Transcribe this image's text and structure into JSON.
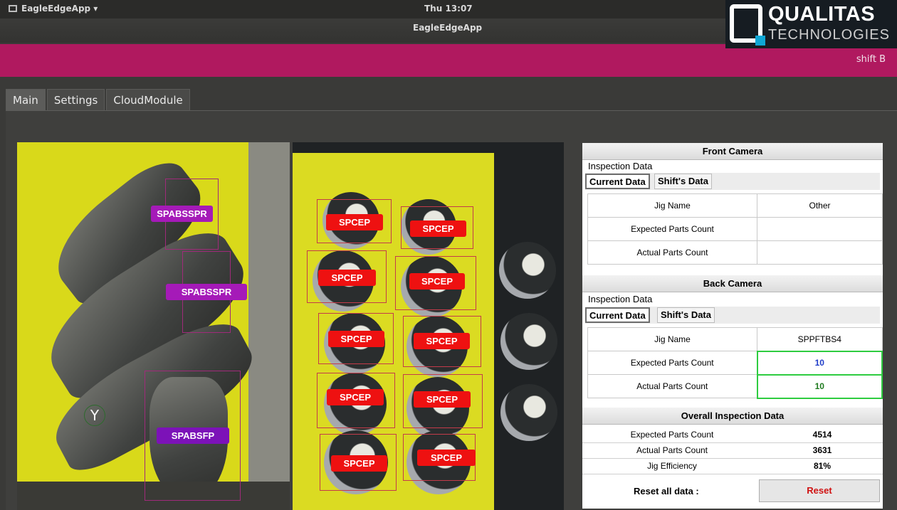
{
  "system": {
    "app_menu": "EagleEdgeApp ▾",
    "clock": "Thu 13:07"
  },
  "window": {
    "title": "EagleEdgeApp"
  },
  "brand": {
    "logo_main": "QUALITAS",
    "logo_sub": "TECHNOLOGIES",
    "shift": "shift B",
    "accent": "#b0195f"
  },
  "tabs": [
    {
      "label": "Main",
      "active": true
    },
    {
      "label": "Settings"
    },
    {
      "label": "CloudModule"
    }
  ],
  "cam1": {
    "labels": [
      "SPABSSPR",
      "SPABSSPR",
      "SPABSFP"
    ],
    "badge": "Y"
  },
  "cam2": {
    "labels": [
      "SPCEP",
      "SPCEP",
      "SPCEP",
      "SPCEP",
      "SPCEP",
      "SPCEP",
      "SPCEP",
      "SPCEP",
      "SPCEP",
      "SPCEP"
    ]
  },
  "front": {
    "title": "Front Camera",
    "inspection": "Inspection Data",
    "tab_current": "Current Data",
    "tab_shift": "Shift's Data",
    "rows": [
      {
        "key": "Jig Name",
        "value": "Other"
      },
      {
        "key": "Expected Parts Count",
        "value": ""
      },
      {
        "key": "Actual Parts Count",
        "value": ""
      }
    ]
  },
  "back": {
    "title": "Back Camera",
    "inspection": "Inspection Data",
    "tab_current": "Current Data",
    "tab_shift": "Shift's Data",
    "rows": [
      {
        "key": "Jig Name",
        "value": "SPPFTBS4"
      },
      {
        "key": "Expected Parts Count",
        "value": "10"
      },
      {
        "key": "Actual Parts Count",
        "value": "10"
      }
    ]
  },
  "overall": {
    "title": "Overall Inspection Data",
    "rows": [
      {
        "key": "Expected Parts Count",
        "value": "4514"
      },
      {
        "key": "Actual Parts Count",
        "value": "3631"
      },
      {
        "key": "Jig Efficiency",
        "value": "81%"
      }
    ],
    "reset_label": "Reset all data :",
    "reset_button": "Reset"
  }
}
